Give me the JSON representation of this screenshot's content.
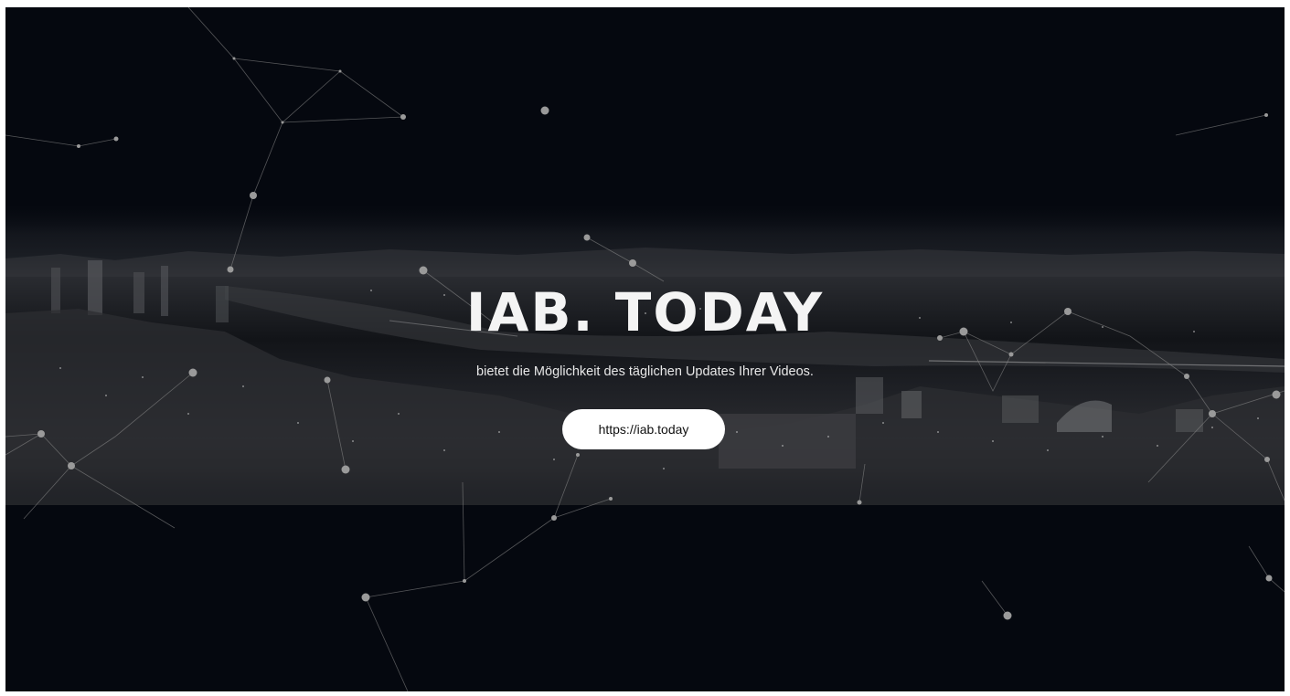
{
  "hero": {
    "title": "IAB. TODAY",
    "tagline": "bietet die Möglichkeit des täglichen Updates Ihrer Videos.",
    "cta_label": "https://iab.today"
  },
  "colors": {
    "background": "#05080f",
    "text": "#f4f4f4",
    "button_bg": "#ffffff",
    "button_text": "#111111",
    "network": "#8a8a8a"
  }
}
